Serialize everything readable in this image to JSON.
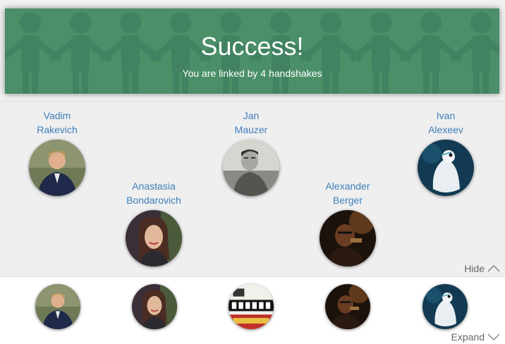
{
  "banner": {
    "title": "Success!",
    "subtitle": "You are linked by 4 handshakes",
    "color": "#4a8f68"
  },
  "chain": {
    "people": [
      {
        "first": "Vadim",
        "last": "Rakevich",
        "avatar": "avatar-man-suit"
      },
      {
        "first": "Anastasia",
        "last": "Bondarovich",
        "avatar": "avatar-woman"
      },
      {
        "first": "Jan",
        "last": "Mauzer",
        "avatar": "avatar-man-bw"
      },
      {
        "first": "Alexander",
        "last": "Berger",
        "avatar": "avatar-man-dark"
      },
      {
        "first": "Ivan",
        "last": "Alexeev",
        "avatar": "avatar-bird"
      }
    ],
    "hide_label": "Hide",
    "link_color": "#3f7fb8"
  },
  "strip": {
    "avatars": [
      "avatar-man-suit",
      "avatar-woman",
      "avatar-poster",
      "avatar-man-dark",
      "avatar-bird"
    ],
    "expand_label": "Expand"
  }
}
